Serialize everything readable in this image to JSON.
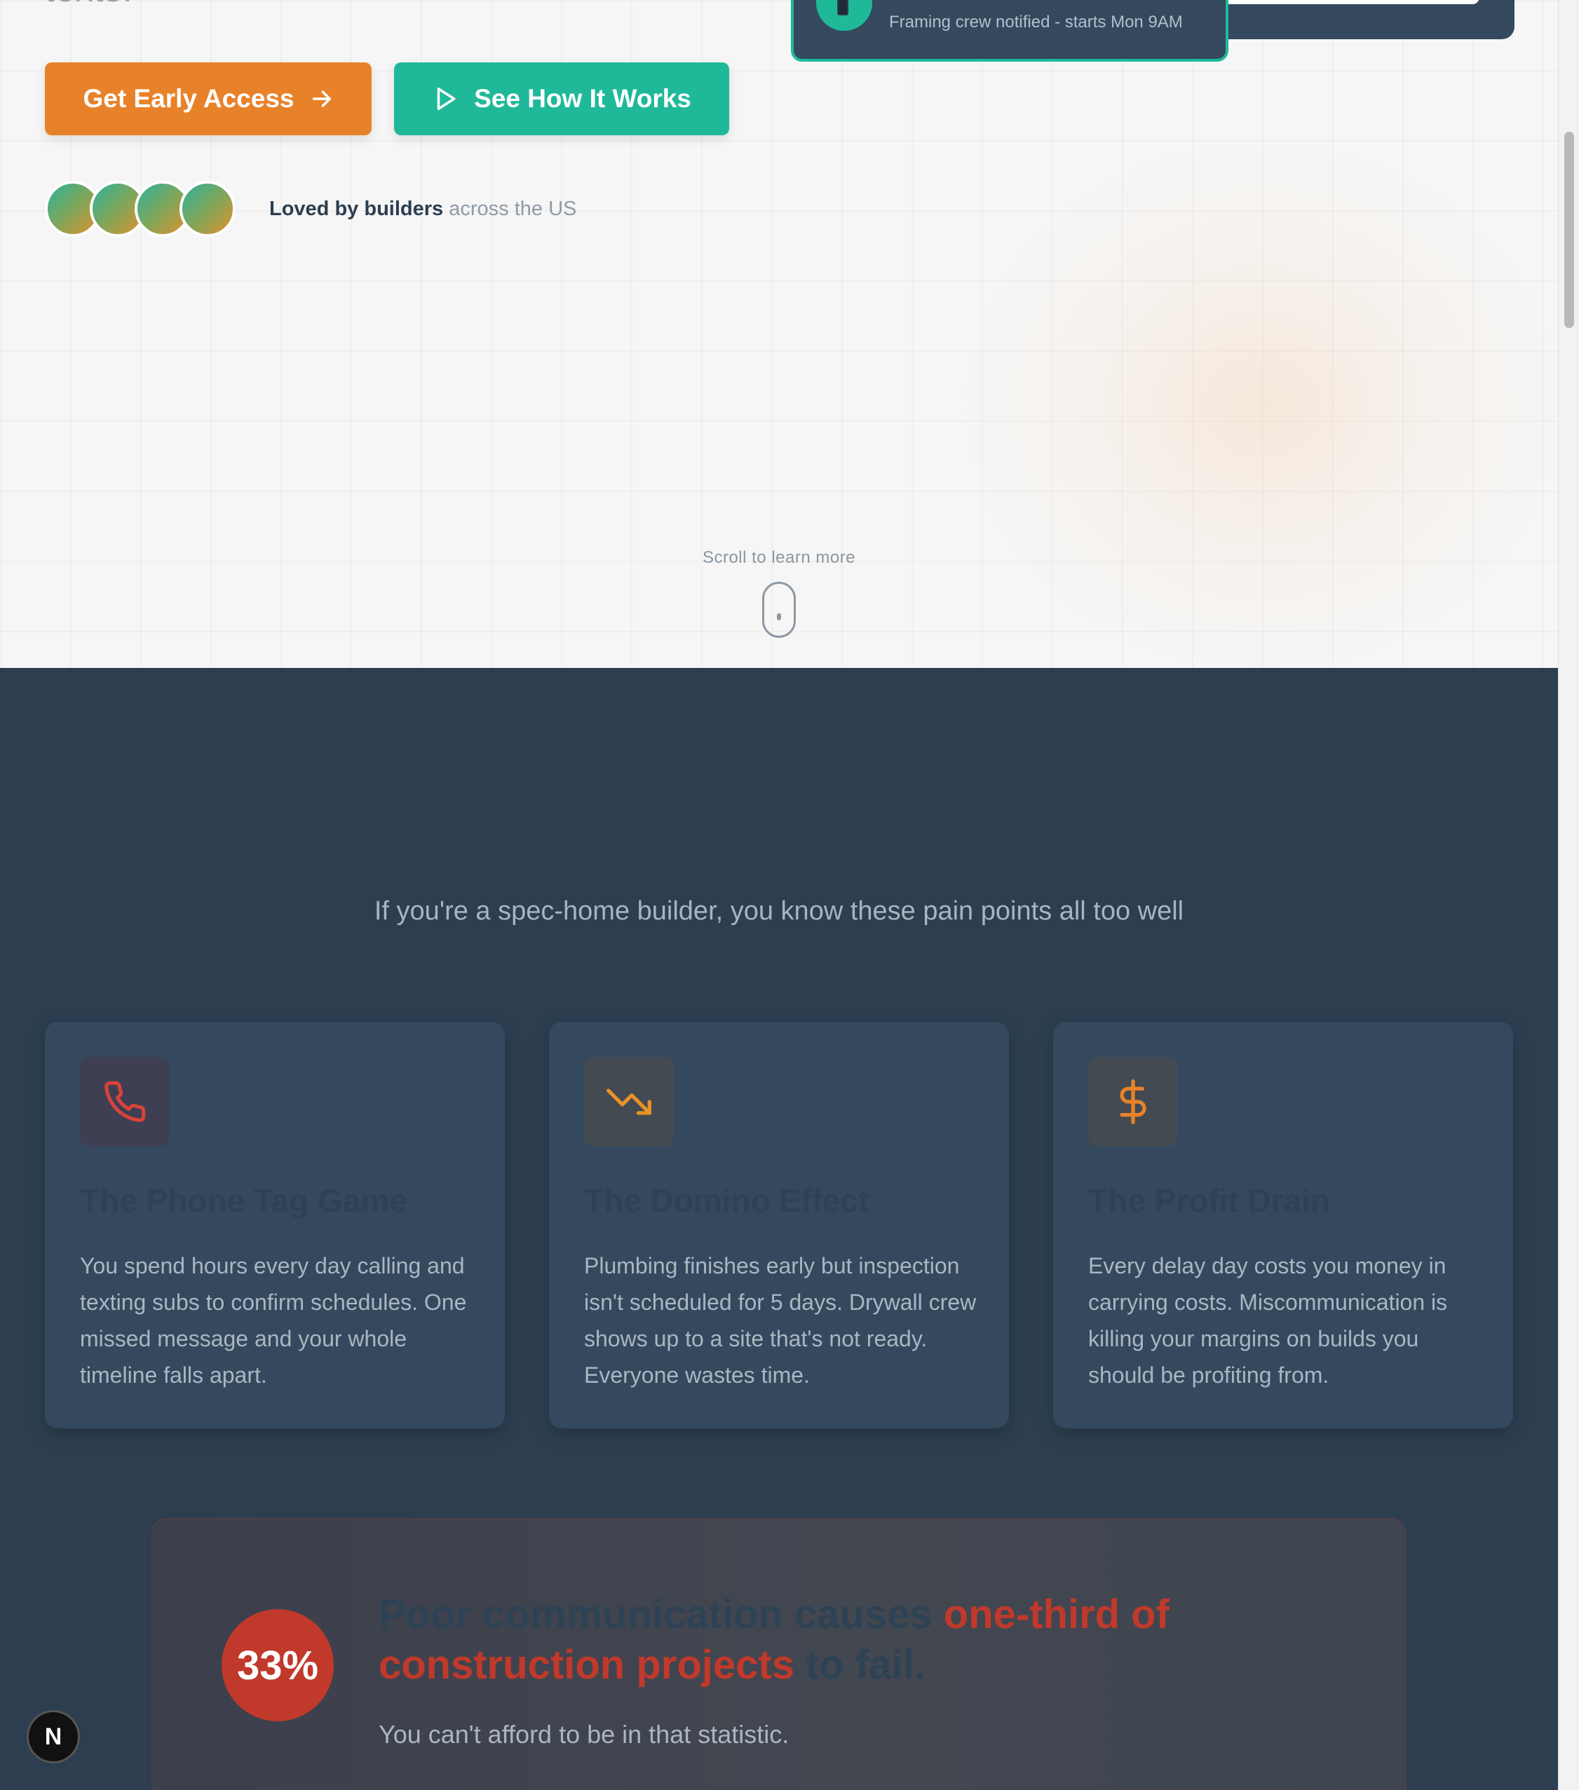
{
  "hero": {
    "cut_text": "texts.",
    "primary_button": {
      "label": "Get Early Access",
      "icon": "arrow-right-icon"
    },
    "secondary_button": {
      "label": "See How It Works",
      "icon": "play-icon"
    },
    "social_proof": {
      "strong": "Loved by builders",
      "rest": "across the US"
    },
    "scroll_hint": "Scroll to learn more"
  },
  "notification": {
    "text": "Framing crew notified - starts Mon 9AM",
    "icon": "phone-icon"
  },
  "pain_points": {
    "subtitle": "If you're a spec-home builder, you know these pain points all too well",
    "cards": [
      {
        "icon": "phone-icon",
        "title": "The Phone Tag Game",
        "body": "You spend hours every day calling and texting subs to confirm schedules. One missed message and your whole timeline falls apart."
      },
      {
        "icon": "trending-down-icon",
        "title": "The Domino Effect",
        "body": "Plumbing finishes early but inspection isn't scheduled for 5 days. Drywall crew shows up to a site that's not ready. Everyone wastes time."
      },
      {
        "icon": "dollar-icon",
        "title": "The Profit Drain",
        "body": "Every delay day costs you money in carrying costs. Miscommunication is killing your margins on builds you should be profiting from."
      }
    ]
  },
  "stat": {
    "badge": "33%",
    "headline_part1": "Poor communication causes ",
    "headline_highlight": "one-third of construction projects",
    "headline_part2": " to fail.",
    "sub": "You can't afford to be in that statistic."
  },
  "dev_badge": "N",
  "colors": {
    "orange": "#e8822a",
    "teal": "#1fb99a",
    "navy": "#2c3e50",
    "card": "#34495e",
    "red": "#c0392b"
  }
}
